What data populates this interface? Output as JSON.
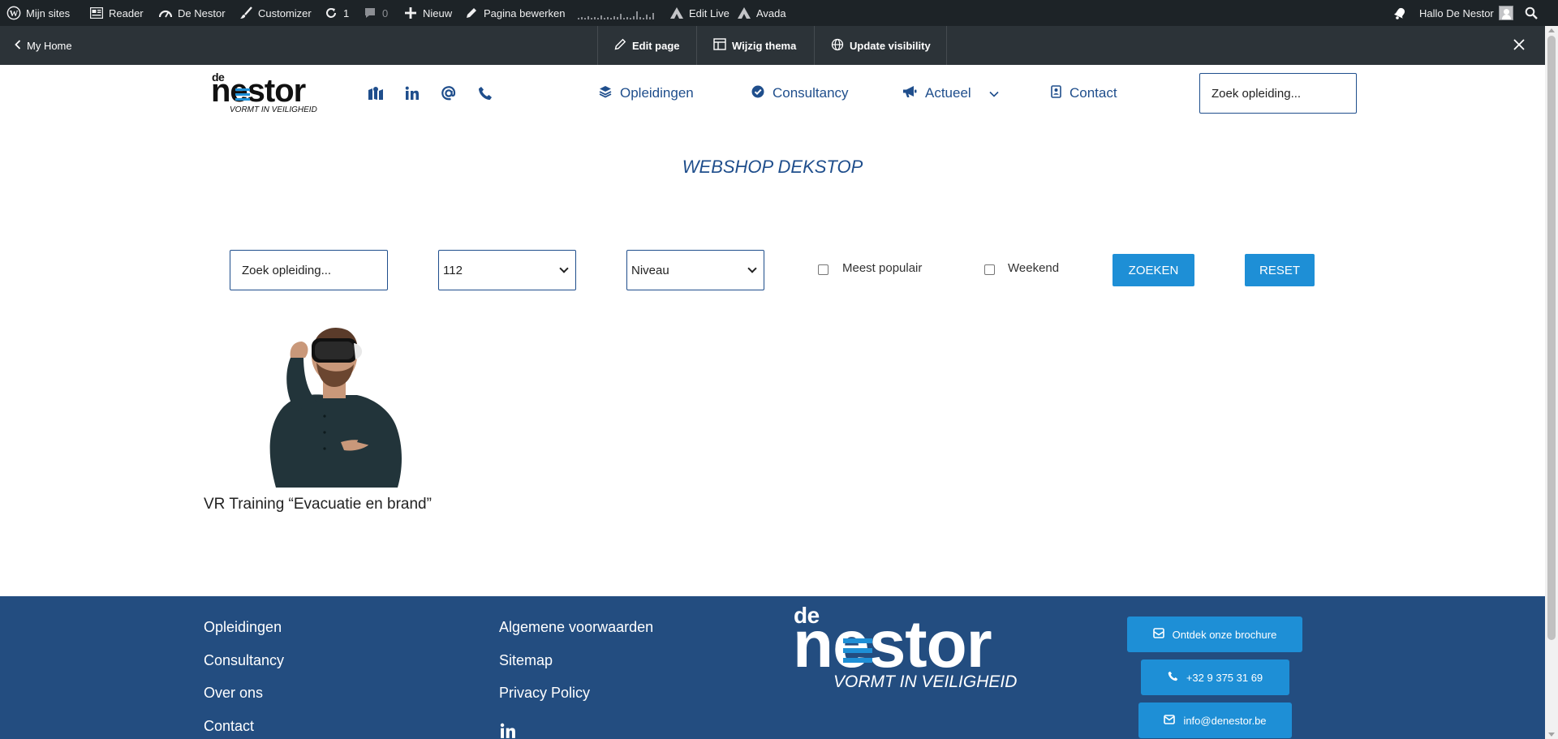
{
  "admin_bar": {
    "my_sites": "Mijn sites",
    "reader": "Reader",
    "site_name": "De Nestor",
    "customizer": "Customizer",
    "updates_count": "1",
    "comments_count": "0",
    "new": "Nieuw",
    "edit_page": "Pagina bewerken",
    "edit_live": "Edit Live",
    "avada": "Avada",
    "greeting": "Hallo De Nestor"
  },
  "edit_bar": {
    "my_home": "My Home",
    "edit_page": "Edit page",
    "change_theme": "Wijzig thema",
    "update_visibility": "Update visibility"
  },
  "header": {
    "logo": {
      "de": "de",
      "name": "nestor",
      "tagline": "VORMT IN VEILIGHEID"
    },
    "nav": [
      {
        "label": "Opleidingen"
      },
      {
        "label": "Consultancy"
      },
      {
        "label": "Actueel"
      },
      {
        "label": "Contact"
      }
    ],
    "search_placeholder": "Zoek opleiding..."
  },
  "page_title": "WEBSHOP DEKSTOP",
  "filters": {
    "search_placeholder": "Zoek opleiding...",
    "location_value": "112",
    "level_value": "Niveau",
    "popular_label": "Meest populair",
    "weekend_label": "Weekend",
    "search_button": "ZOEKEN",
    "reset_button": "RESET"
  },
  "products": [
    {
      "title": "VR Training “Evacuatie en brand”"
    }
  ],
  "footer": {
    "col1": [
      "Opleidingen",
      "Consultancy",
      "Over ons",
      "Contact"
    ],
    "col2": [
      "Algemene voorwaarden",
      "Sitemap",
      "Privacy Policy"
    ],
    "logo": {
      "de": "de",
      "name": "nestor",
      "tagline": "VORMT IN VEILIGHEID"
    },
    "buttons": {
      "brochure": "Ontdek onze brochure",
      "phone": "+32 9 375 31 69",
      "email": "info@denestor.be"
    }
  },
  "colors": {
    "admin_bar": "#1d2327",
    "edit_bar": "#2c3338",
    "brand_blue": "#1f4e8c",
    "accent_blue": "#1e8fd6",
    "footer_bg": "#234d80"
  }
}
